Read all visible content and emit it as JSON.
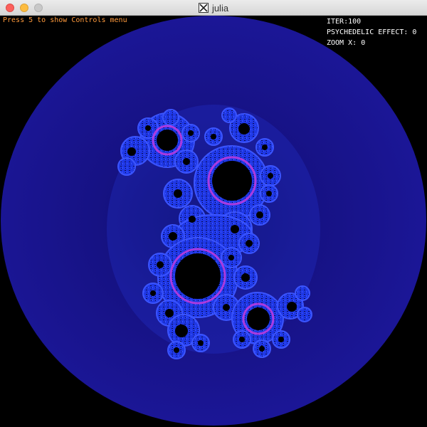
{
  "window": {
    "title": "julia",
    "app_icon": "x11-icon"
  },
  "hud": {
    "hint": "Press 5 to show Controls menu",
    "iter_label": "ITER:",
    "iter_value": "100",
    "psychedelic_label": "PSYCHEDELIC EFFECT:",
    "psychedelic_value": "0",
    "zoom_label": "ZOOM X:",
    "zoom_value": "0"
  },
  "colors": {
    "background": "#000000",
    "disc": "#1a1690",
    "fractal_body": "#1e3cf0",
    "fractal_edge": "#3a4cff",
    "fractal_highlight": "#c23ce0",
    "hole": "#000000",
    "hint_text": "#ff9a3c",
    "hud_text": "#ffffff"
  }
}
